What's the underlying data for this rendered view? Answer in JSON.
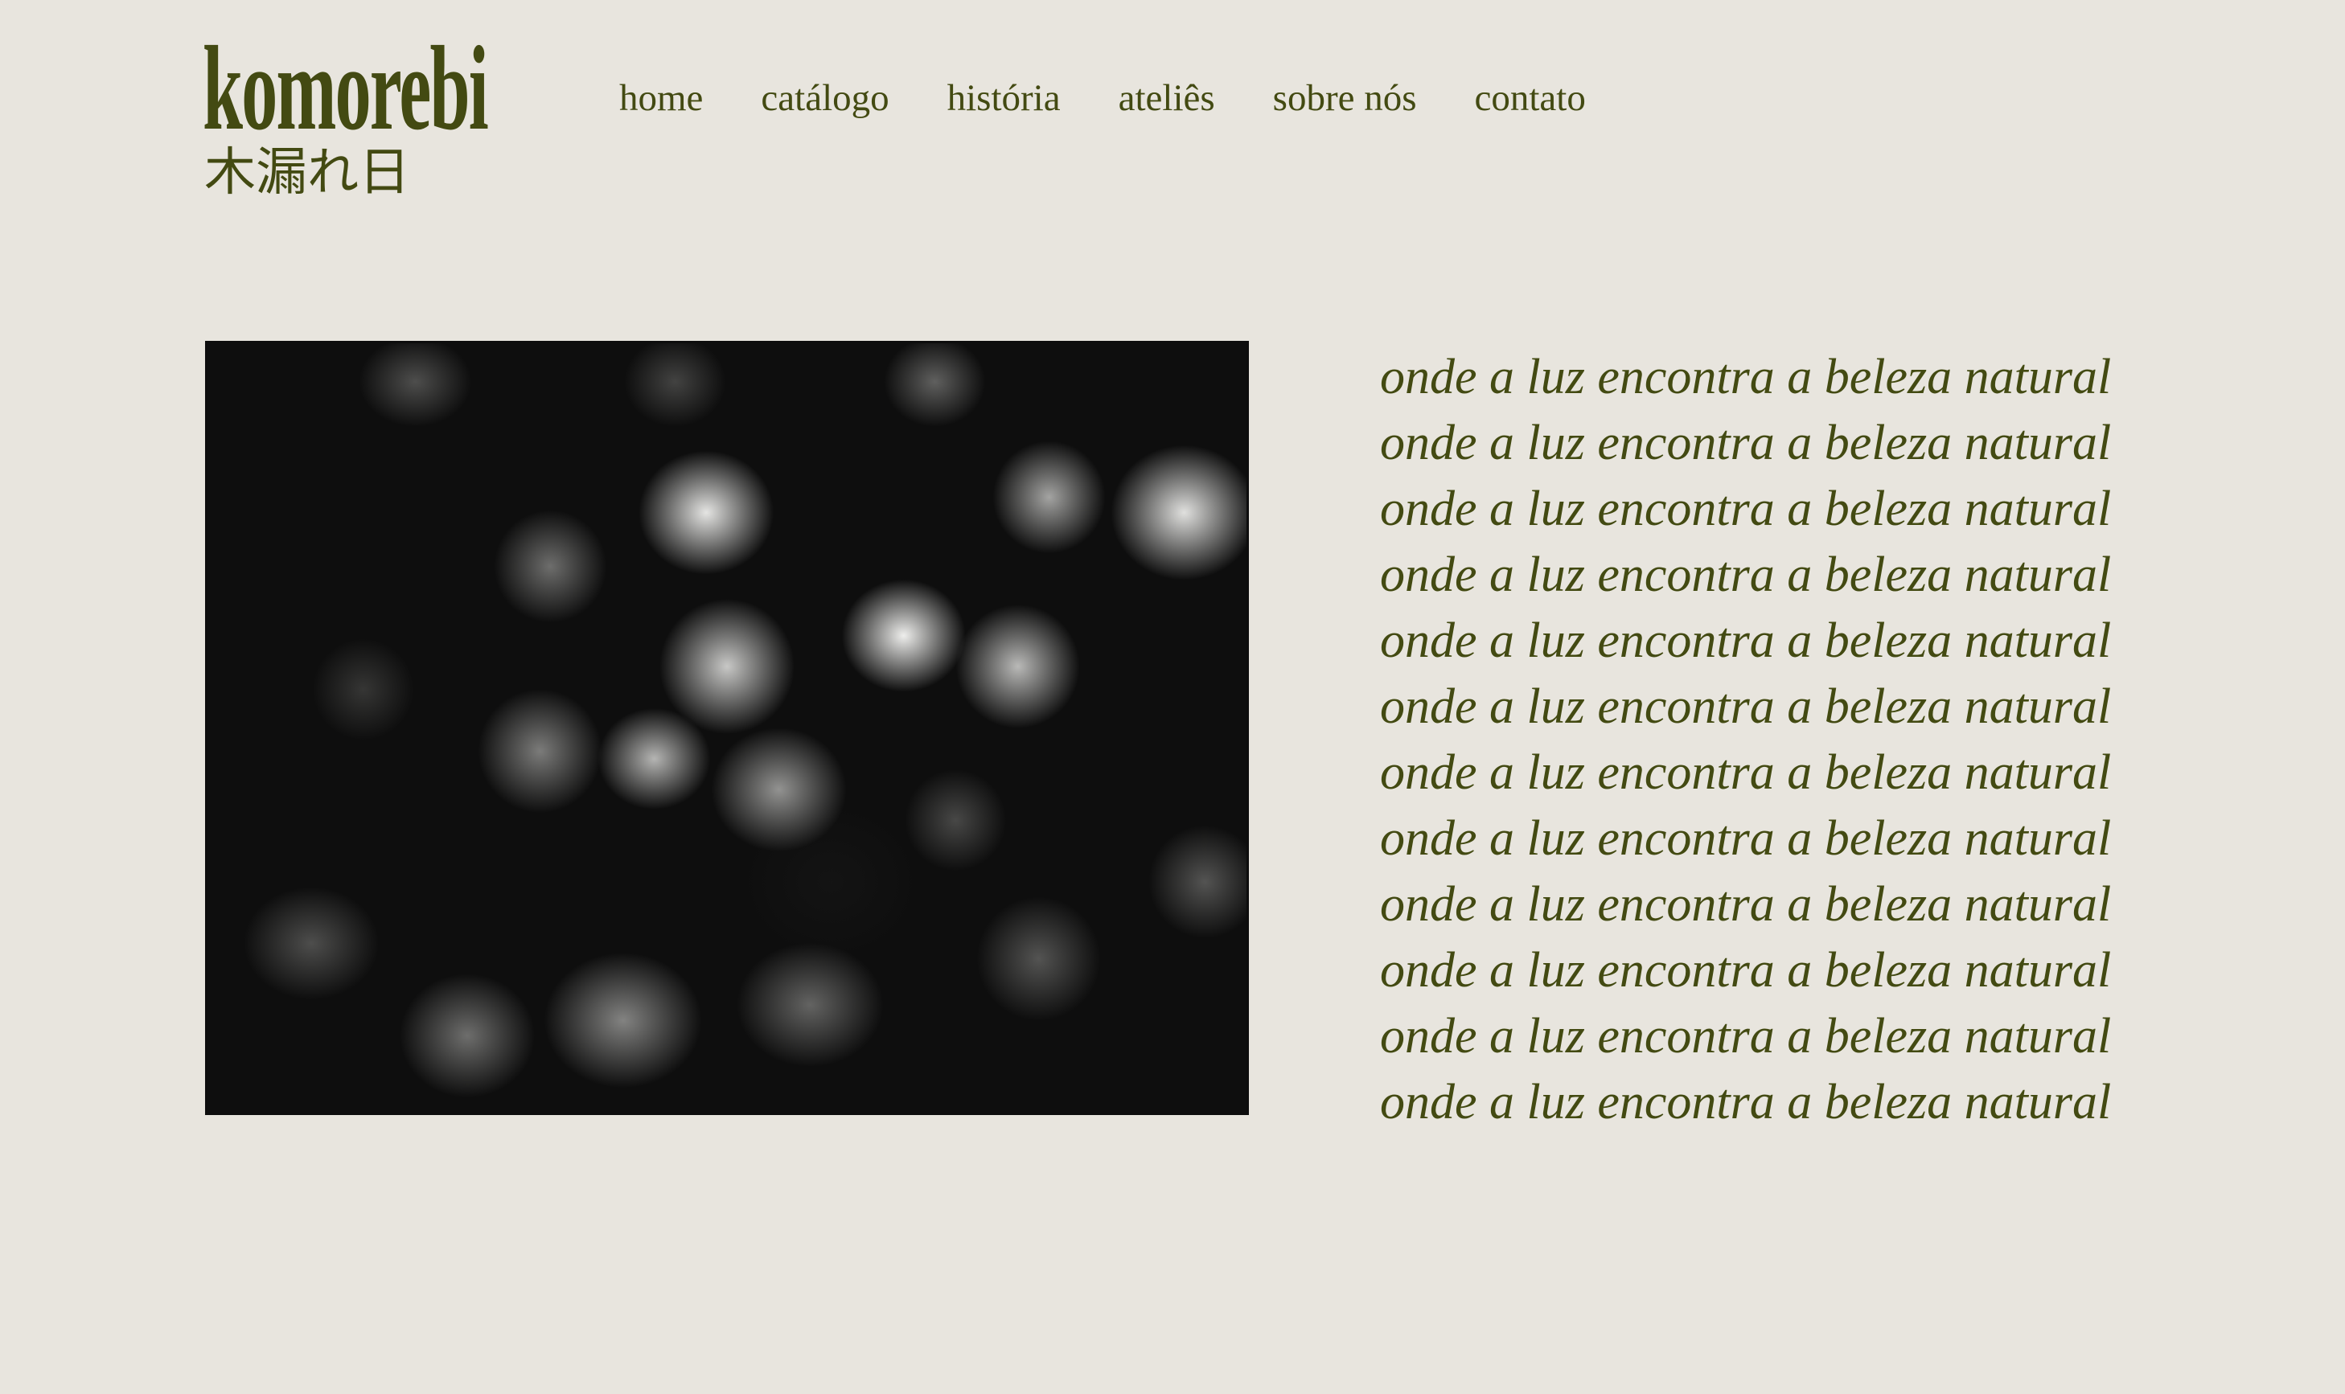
{
  "brand": {
    "name": "komorebi",
    "kanji": "木漏れ日"
  },
  "nav": {
    "items": [
      {
        "label": "home"
      },
      {
        "label": "catálogo"
      },
      {
        "label": "história"
      },
      {
        "label": "ateliês"
      },
      {
        "label": "sobre nós"
      },
      {
        "label": "contato"
      }
    ]
  },
  "hero": {
    "photo": "black-and-white bokeh photograph of sunlight through leaves",
    "tagline_lines": [
      "onde a luz encontra a beleza natural",
      "onde a luz encontra a beleza natural",
      "onde a luz encontra a beleza natural",
      "onde a luz encontra a beleza natural",
      "onde a luz encontra a beleza natural",
      "onde a luz encontra a beleza natural",
      "onde a luz encontra a beleza natural",
      "onde a luz encontra a beleza natural",
      "onde a luz encontra a beleza natural",
      "onde a luz encontra a beleza natural",
      "onde a luz encontra a beleza natural",
      "onde a luz encontra a beleza natural"
    ]
  },
  "colors": {
    "background": "#e8e5de",
    "text": "#434a12",
    "photo_border": "#0d0d0d"
  }
}
